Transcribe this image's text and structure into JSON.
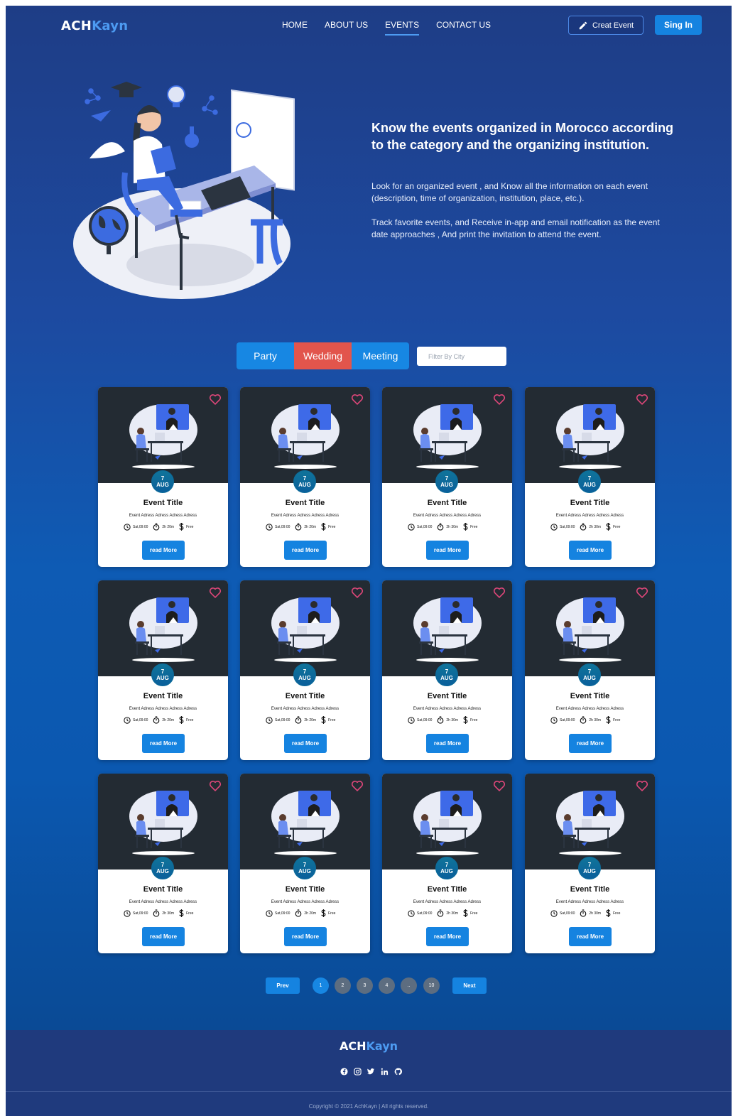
{
  "nav": {
    "logo_a": "ACH",
    "logo_b": "Kayn",
    "links": [
      "HOME",
      "ABOUT US",
      "EVENTS",
      "CONTACT US"
    ],
    "active_link": "EVENTS",
    "create_label": "Creat Event",
    "signin_label": "Sing In"
  },
  "hero": {
    "title": "Know the events organized in Morocco according to the category and the organizing institution.",
    "p1": "Look for an organized event , and Know all the information on each event (description, time of organization, institution, place, etc.).",
    "p2": "Track favorite events, and Receive in-app and email notification as the event date approaches , And print the invitation to attend the event."
  },
  "filters": {
    "tabs": [
      "Party",
      "Wedding",
      "Meeting"
    ],
    "active_tab": "Wedding",
    "city_placeholder": "Filter By City"
  },
  "cards": [
    {
      "day": "7",
      "month": "AUG",
      "title": "Event Title",
      "address": "Event Adress Adress Adress Adress",
      "time": "Sat,09:00",
      "duration": "2h 20m",
      "price": "Free",
      "cta": "read More"
    },
    {
      "day": "7",
      "month": "AUG",
      "title": "Event Title",
      "address": "Event Adress Adress Adress Adress",
      "time": "Sat,09:00",
      "duration": "2h 20m",
      "price": "Free",
      "cta": "read More"
    },
    {
      "day": "7",
      "month": "AUG",
      "title": "Event Title",
      "address": "Event Adress Adress Adress Adress",
      "time": "Sat,09:00",
      "duration": "2h 30m",
      "price": "Free",
      "cta": "read More"
    },
    {
      "day": "7",
      "month": "AUG",
      "title": "Event Title",
      "address": "Event Adress Adress Adress Adress",
      "time": "Sat,09:00",
      "duration": "2h 30m",
      "price": "Free",
      "cta": "read More"
    },
    {
      "day": "7",
      "month": "AUG",
      "title": "Event Title",
      "address": "Event Adress Adress Adress Adress",
      "time": "Sat,09:00",
      "duration": "2h 20m",
      "price": "Free",
      "cta": "read More"
    },
    {
      "day": "7",
      "month": "AUG",
      "title": "Event Title",
      "address": "Event Adress Adress Adress Adress",
      "time": "Sat,09:00",
      "duration": "2h 20m",
      "price": "Free",
      "cta": "read More"
    },
    {
      "day": "7",
      "month": "AUG",
      "title": "Event Title",
      "address": "Event Adress Adress Adress Adress",
      "time": "Sat,09:00",
      "duration": "2h 30m",
      "price": "Free",
      "cta": "read More"
    },
    {
      "day": "7",
      "month": "AUG",
      "title": "Event Title",
      "address": "Event Adress Adress Adress Adress",
      "time": "Sat,09:00",
      "duration": "2h 30m",
      "price": "Free",
      "cta": "read More"
    },
    {
      "day": "7",
      "month": "AUG",
      "title": "Event Title",
      "address": "Event Adress Adress Adress Adress",
      "time": "Sat,09:00",
      "duration": "2h 30m",
      "price": "Free",
      "cta": "read More"
    },
    {
      "day": "7",
      "month": "AUG",
      "title": "Event Title",
      "address": "Event Adress Adress Adress Adress",
      "time": "Sat,09:00",
      "duration": "2h 20m",
      "price": "Free",
      "cta": "read More"
    },
    {
      "day": "7",
      "month": "AUG",
      "title": "Event Title",
      "address": "Event Adress Adress Adress Adress",
      "time": "Sat,09:00",
      "duration": "2h 30m",
      "price": "Free",
      "cta": "read More"
    },
    {
      "day": "7",
      "month": "AUG",
      "title": "Event Title",
      "address": "Event Adress Adress Adress Adress",
      "time": "Sat,09:00",
      "duration": "2h 30m",
      "price": "Free",
      "cta": "read More"
    }
  ],
  "pagination": {
    "prev": "Prev",
    "next": "Next",
    "pages": [
      "1",
      "2",
      "3",
      "4",
      "..",
      "10"
    ],
    "active_page": "1"
  },
  "footer": {
    "logo_a": "ACH",
    "logo_b": "Kayn",
    "socials": [
      "facebook-icon",
      "instagram-icon",
      "twitter-icon",
      "linkedin-icon",
      "github-icon"
    ],
    "copyright": "Copyright © 2021 AchKayn | All rights reserved."
  },
  "colors": {
    "accent": "#1583e0",
    "active_tab": "#e2554c",
    "heart": "#e0477a",
    "footer_bg": "#1f3a7d"
  }
}
